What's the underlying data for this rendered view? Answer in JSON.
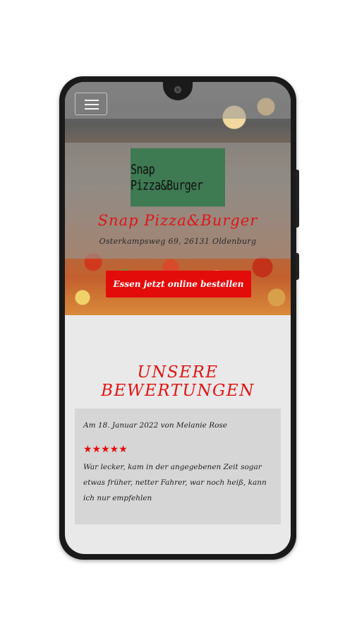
{
  "header": {
    "menu_icon": "hamburger-menu-icon"
  },
  "hero": {
    "logo_text": "Snap Pizza&Burger",
    "title": "Snap Pizza&Burger",
    "address": "Osterkampsweg 69,  26131 Oldenburg",
    "order_button_label": "Essen jetzt online bestellen"
  },
  "reviews": {
    "section_title": "UNSERE BEWERTUNGEN",
    "items": [
      {
        "meta": "Am 18.  Januar 2022 von Melanie Rose",
        "rating": 5,
        "stars": "★★★★★",
        "text": "War lecker,  kam in der angegebenen Zeit sogar etwas früher, netter Fahrer, war noch heiß, kann ich nur empfehlen"
      }
    ]
  },
  "colors": {
    "accent_red": "#e40b0b",
    "logo_green": "#3e7a52"
  }
}
